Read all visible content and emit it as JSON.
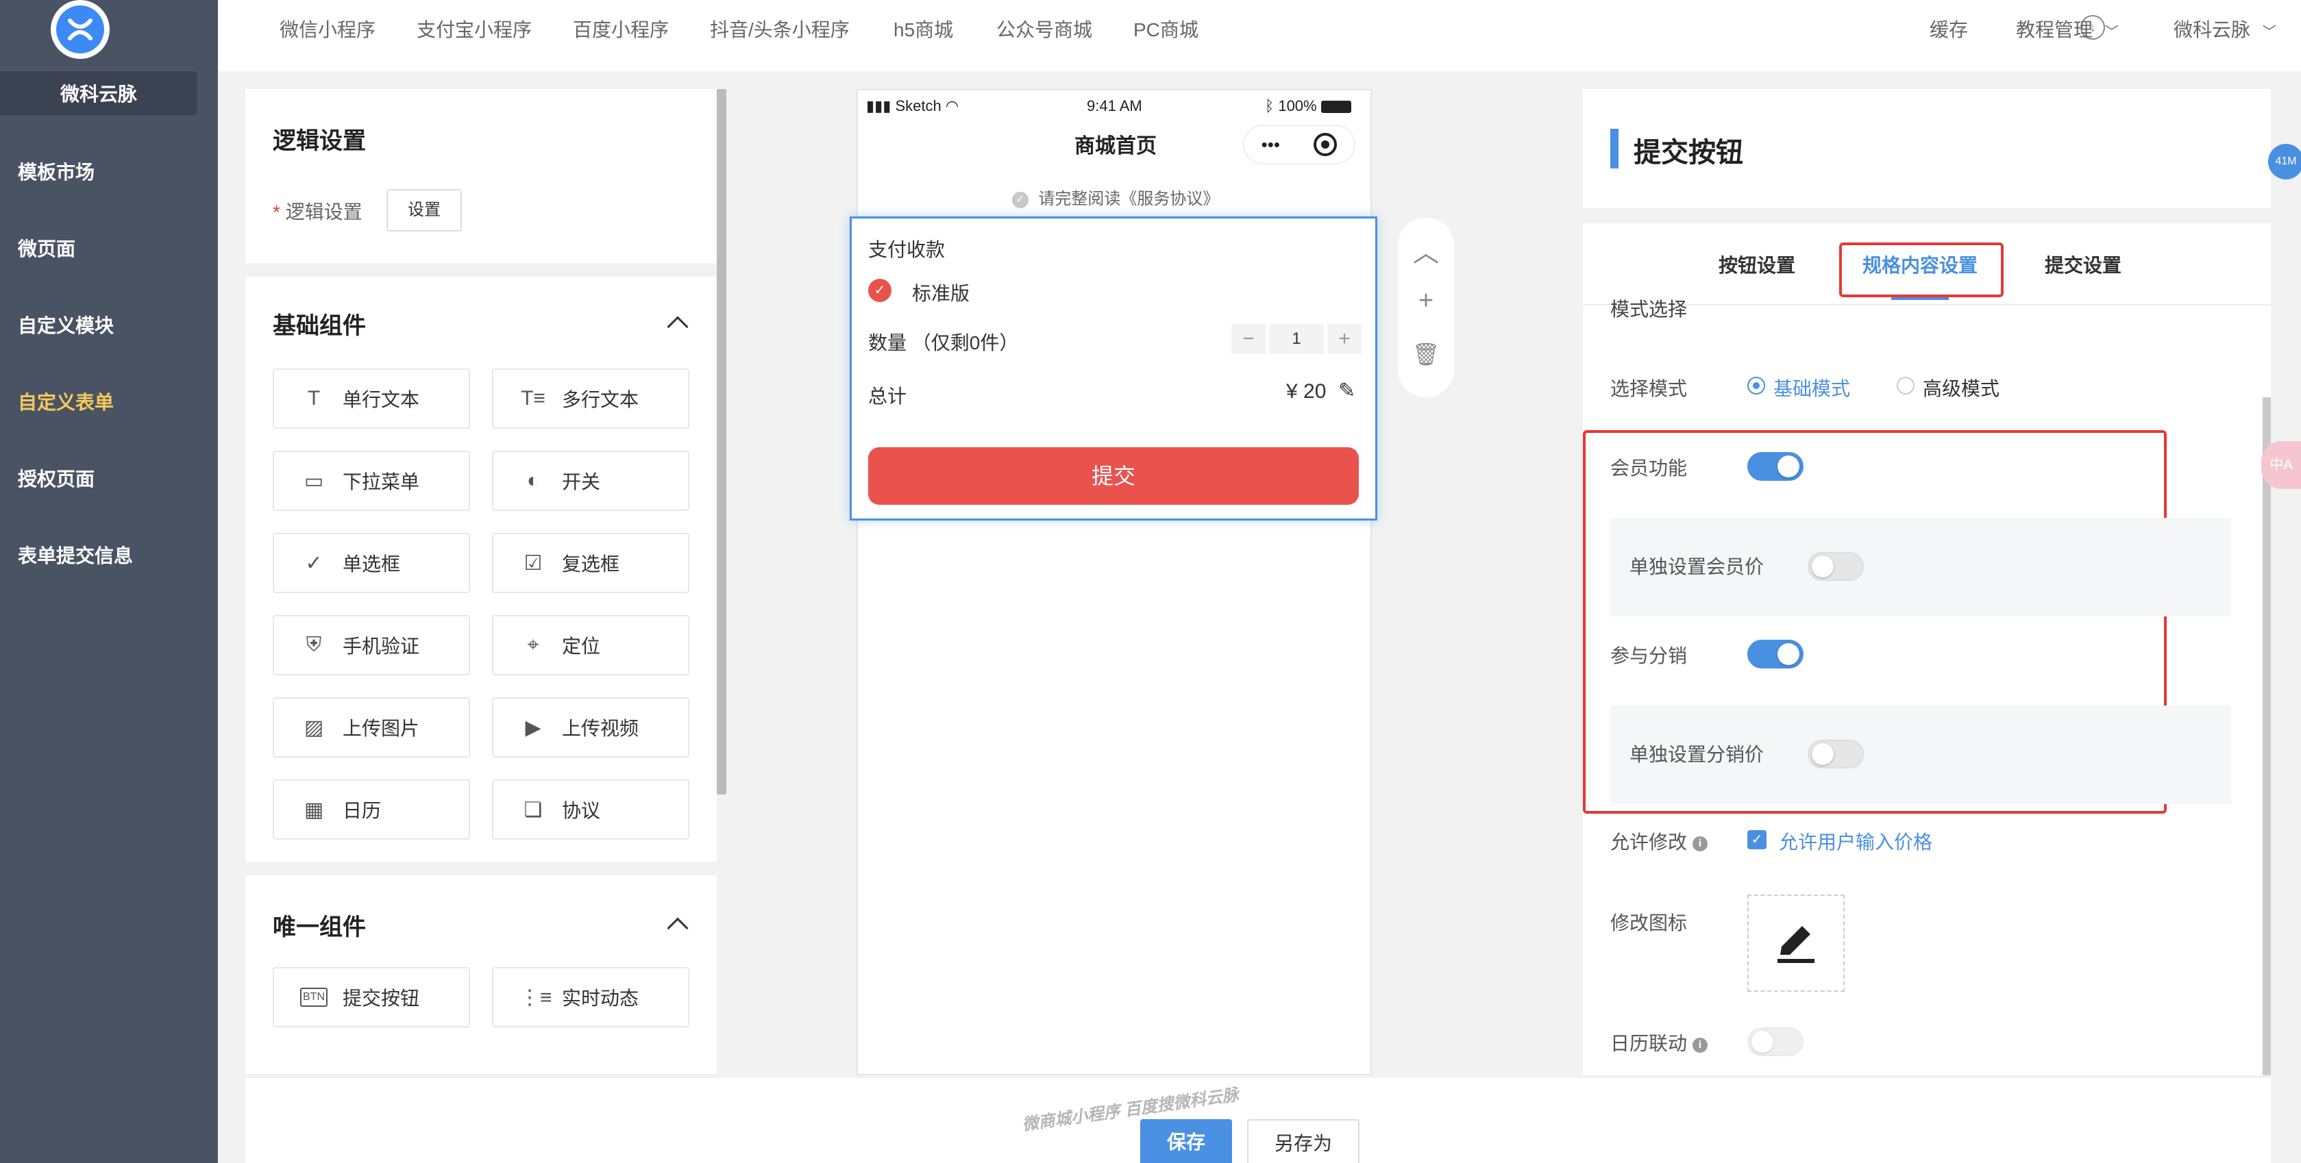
{
  "sidebar": {
    "brand": "微科云脉",
    "items": [
      {
        "label": "模板市场",
        "active": false
      },
      {
        "label": "微页面",
        "active": false
      },
      {
        "label": "自定义模块",
        "active": false
      },
      {
        "label": "自定义表单",
        "active": true
      },
      {
        "label": "授权页面",
        "active": false
      },
      {
        "label": "表单提交信息",
        "active": false
      }
    ]
  },
  "topnav": {
    "tabs": [
      "微信小程序",
      "支付宝小程序",
      "百度小程序",
      "抖音/头条小程序",
      "h5商城",
      "公众号商城",
      "PC商城"
    ],
    "cache": "缓存",
    "tutorial": "教程管理",
    "user": "微科云脉"
  },
  "left_panel": {
    "logic": {
      "title": "逻辑设置",
      "label": "逻辑设置",
      "required_mark": "*",
      "button": "设置"
    },
    "basic": {
      "title": "基础组件",
      "items": [
        {
          "label": "单行文本",
          "icon": "T"
        },
        {
          "label": "多行文本",
          "icon": "T≡"
        },
        {
          "label": "下拉菜单",
          "icon": "▭"
        },
        {
          "label": "开关",
          "icon": "◐"
        },
        {
          "label": "单选框",
          "icon": "✓"
        },
        {
          "label": "复选框",
          "icon": "☑"
        },
        {
          "label": "手机验证",
          "icon": "⛨"
        },
        {
          "label": "定位",
          "icon": "⌖"
        },
        {
          "label": "上传图片",
          "icon": "▨"
        },
        {
          "label": "上传视频",
          "icon": "▶"
        },
        {
          "label": "日历",
          "icon": "▦"
        },
        {
          "label": "协议",
          "icon": "❏"
        }
      ]
    },
    "unique": {
      "title": "唯一组件",
      "items": [
        {
          "label": "提交按钮",
          "icon": "BTN"
        },
        {
          "label": "实时动态",
          "icon": "⋮≡"
        }
      ]
    }
  },
  "phone": {
    "carrier": "Sketch",
    "time": "9:41 AM",
    "battery": "100%",
    "title": "商城首页",
    "capsule_more": "•••",
    "agreement": "请完整阅读《服务协议》",
    "form": {
      "section_title": "支付收款",
      "option": "标准版",
      "quantity_label": "数量 （仅剩0件）",
      "quantity_value": "1",
      "minus": "−",
      "plus": "+",
      "total_label": "总计",
      "total_value": "¥ 20",
      "submit": "提交"
    }
  },
  "right_panel": {
    "title": "提交按钮",
    "tabs": [
      {
        "label": "按钮设置",
        "active": false
      },
      {
        "label": "规格内容设置",
        "active": true
      },
      {
        "label": "提交设置",
        "active": false
      }
    ],
    "partial_label": "模式选择",
    "mode": {
      "label": "选择模式",
      "options": [
        "基础模式",
        "高级模式"
      ],
      "selected": "基础模式"
    },
    "member": {
      "label": "会员功能",
      "on": true
    },
    "member_price": {
      "label": "单独设置会员价",
      "on": false
    },
    "distribution": {
      "label": "参与分销",
      "on": true
    },
    "distribution_price": {
      "label": "单独设置分销价",
      "on": false
    },
    "allow_edit": {
      "label": "允许修改",
      "checkbox_label": "允许用户输入价格",
      "checked": true
    },
    "edit_icon": {
      "label": "修改图标"
    },
    "calendar_link": {
      "label": "日历联动",
      "on": false
    },
    "accent": "#4a90e2",
    "highlight": "#e53935"
  },
  "footer": {
    "save": "保存",
    "save_as": "另存为",
    "watermark": "微商城小程序 百度搜微科云脉"
  },
  "badges": {
    "memory": "41M",
    "side": "中A"
  }
}
